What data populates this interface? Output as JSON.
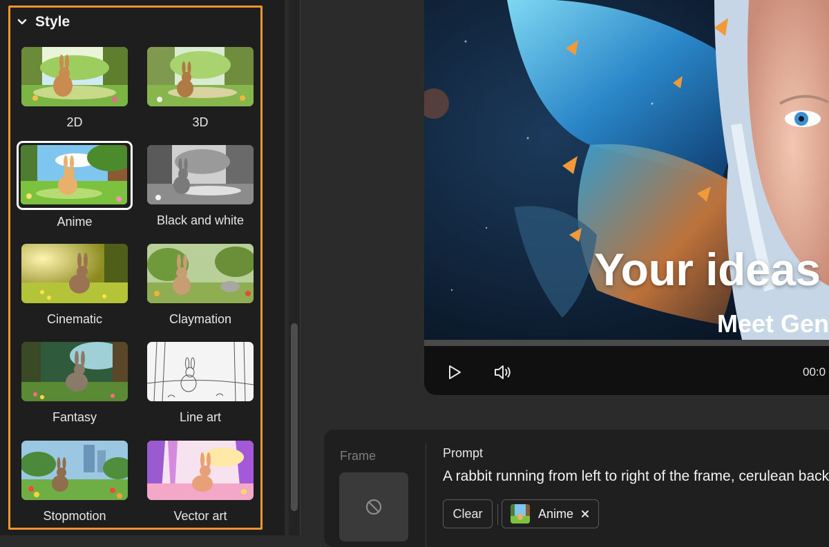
{
  "style_panel": {
    "title": "Style",
    "styles": [
      {
        "label": "2D",
        "selected": false
      },
      {
        "label": "3D",
        "selected": false
      },
      {
        "label": "Anime",
        "selected": true
      },
      {
        "label": "Black and white",
        "selected": false
      },
      {
        "label": "Cinematic",
        "selected": false
      },
      {
        "label": "Claymation",
        "selected": false
      },
      {
        "label": "Fantasy",
        "selected": false
      },
      {
        "label": "Line art",
        "selected": false
      },
      {
        "label": "Stopmotion",
        "selected": false
      },
      {
        "label": "Vector art",
        "selected": false
      }
    ]
  },
  "video": {
    "headline": "Your ideas",
    "subheadline": "Meet Gen",
    "timecode": "00:0",
    "progress": 0
  },
  "prompt_panel": {
    "frame_label": "Frame",
    "prompt_label": "Prompt",
    "prompt_text": "A rabbit running from left to right of the frame, cerulean backg",
    "clear_label": "Clear",
    "style_chip_label": "Anime"
  },
  "colors": {
    "accent_border": "#f0962e",
    "panel_bg": "#1e1e1e",
    "app_bg": "#2b2b2b"
  }
}
